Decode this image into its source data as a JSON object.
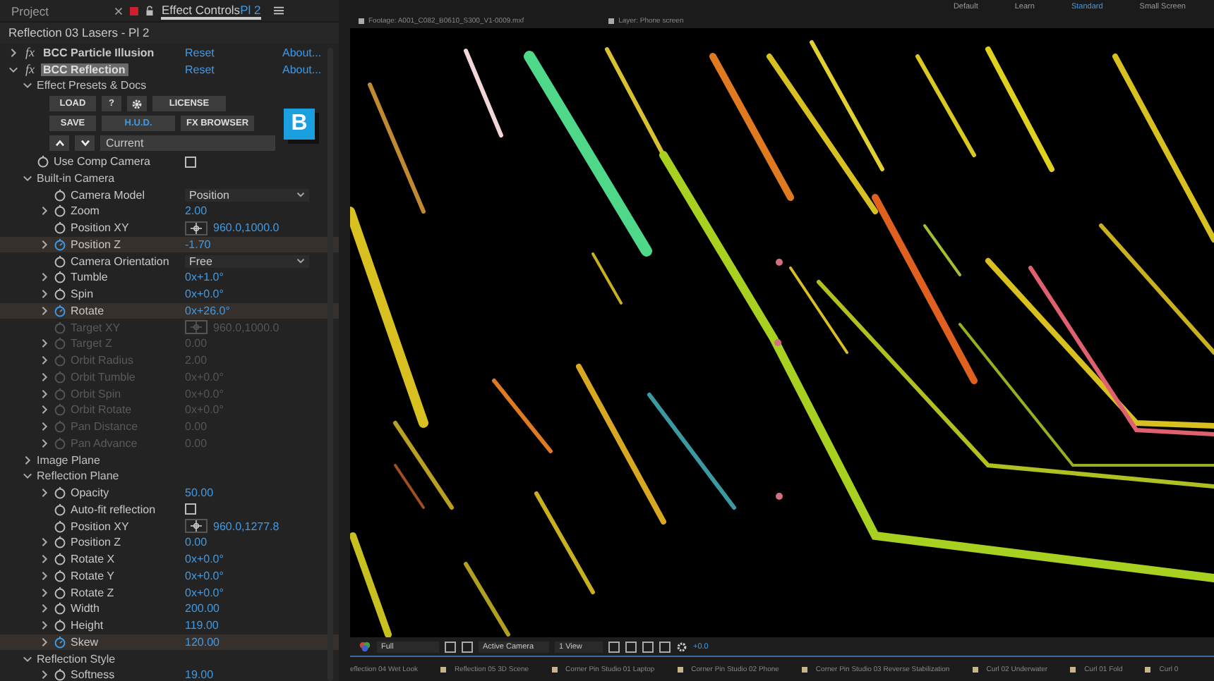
{
  "panel_tabs": [
    {
      "label": "Project",
      "selected": false
    },
    {
      "label": "Effect Controls",
      "suffix": "Pl 2",
      "selected": true
    }
  ],
  "layer_title": "Reflection 03 Lasers - Pl 2",
  "effects": [
    {
      "fx": "fx",
      "name": "BCC Particle Illusion",
      "reset": "Reset",
      "about": "About...",
      "expanded": false,
      "selected": false
    },
    {
      "fx": "fx",
      "name": "BCC Reflection",
      "reset": "Reset",
      "about": "About...",
      "expanded": true,
      "selected": true,
      "params": [
        {
          "kind": "presets",
          "label": "Effect Presets & Docs",
          "expanded": true,
          "logo": "B",
          "preset_field": "Current",
          "button_rows": [
            [
              {
                "kind": "text",
                "label": "LOAD",
                "on": false
              },
              {
                "kind": "text",
                "label": "?",
                "on": false
              },
              {
                "kind": "gear"
              },
              {
                "kind": "text",
                "label": "LICENSE",
                "on": false
              }
            ],
            [
              {
                "kind": "text",
                "label": "SAVE",
                "on": false
              },
              {
                "kind": "text",
                "label": "H.U.D.",
                "on": true
              },
              {
                "kind": "text",
                "label": "FX BROWSER",
                "on": false
              }
            ],
            [
              {
                "kind": "up"
              },
              {
                "kind": "down"
              }
            ]
          ]
        },
        {
          "kind": "checkbox",
          "label": "Use Comp Camera",
          "checked": false,
          "expandable": false,
          "keyframed": false,
          "disabled": false
        },
        {
          "kind": "section",
          "label": "Built-in Camera",
          "expanded": true,
          "children": [
            {
              "kind": "dropdown",
              "label": "Camera Model",
              "value": "Position",
              "expandable": false,
              "keyframed": false,
              "disabled": false
            },
            {
              "kind": "value",
              "label": "Zoom",
              "value": "2.00",
              "expandable": true,
              "keyframed": false,
              "disabled": false
            },
            {
              "kind": "point",
              "label": "Position XY",
              "value": "960.0,1000.0",
              "expandable": false,
              "keyframed": false,
              "disabled": false
            },
            {
              "kind": "value",
              "label": "Position Z",
              "value": "-1.70",
              "expandable": true,
              "keyframed": true,
              "disabled": false
            },
            {
              "kind": "dropdown",
              "label": "Camera Orientation",
              "value": "Free",
              "expandable": false,
              "keyframed": false,
              "disabled": false
            },
            {
              "kind": "value",
              "label": "Tumble",
              "value": "0x+1.0°",
              "expandable": true,
              "keyframed": false,
              "disabled": false
            },
            {
              "kind": "value",
              "label": "Spin",
              "value": "0x+0.0°",
              "expandable": true,
              "keyframed": false,
              "disabled": false
            },
            {
              "kind": "value",
              "label": "Rotate",
              "value": "0x+26.0°",
              "expandable": true,
              "keyframed": true,
              "disabled": false
            },
            {
              "kind": "point",
              "label": "Target XY",
              "value": "960.0,1000.0",
              "expandable": false,
              "keyframed": false,
              "disabled": true
            },
            {
              "kind": "value",
              "label": "Target Z",
              "value": "0.00",
              "expandable": true,
              "keyframed": false,
              "disabled": true
            },
            {
              "kind": "value",
              "label": "Orbit Radius",
              "value": "2.00",
              "expandable": true,
              "keyframed": false,
              "disabled": true
            },
            {
              "kind": "value",
              "label": "Orbit Tumble",
              "value": "0x+0.0°",
              "expandable": true,
              "keyframed": false,
              "disabled": true
            },
            {
              "kind": "value",
              "label": "Orbit Spin",
              "value": "0x+0.0°",
              "expandable": true,
              "keyframed": false,
              "disabled": true
            },
            {
              "kind": "value",
              "label": "Orbit Rotate",
              "value": "0x+0.0°",
              "expandable": true,
              "keyframed": false,
              "disabled": true
            },
            {
              "kind": "value",
              "label": "Pan Distance",
              "value": "0.00",
              "expandable": true,
              "keyframed": false,
              "disabled": true
            },
            {
              "kind": "value",
              "label": "Pan Advance",
              "value": "0.00",
              "expandable": true,
              "keyframed": false,
              "disabled": true
            }
          ]
        },
        {
          "kind": "section",
          "label": "Image Plane",
          "expanded": false
        },
        {
          "kind": "section",
          "label": "Reflection Plane",
          "expanded": true,
          "children": [
            {
              "kind": "value",
              "label": "Opacity",
              "value": "50.00",
              "expandable": true,
              "keyframed": false,
              "disabled": false
            },
            {
              "kind": "checkbox",
              "label": "Auto-fit reflection",
              "checked": false,
              "expandable": false,
              "keyframed": false,
              "disabled": false
            },
            {
              "kind": "point",
              "label": "Position XY",
              "value": "960.0,1277.8",
              "expandable": false,
              "keyframed": false,
              "disabled": false
            },
            {
              "kind": "value",
              "label": "Position Z",
              "value": "0.00",
              "expandable": true,
              "keyframed": false,
              "disabled": false
            },
            {
              "kind": "value",
              "label": "Rotate X",
              "value": "0x+0.0°",
              "expandable": true,
              "keyframed": false,
              "disabled": false
            },
            {
              "kind": "value",
              "label": "Rotate Y",
              "value": "0x+0.0°",
              "expandable": true,
              "keyframed": false,
              "disabled": false
            },
            {
              "kind": "value",
              "label": "Rotate Z",
              "value": "0x+0.0°",
              "expandable": true,
              "keyframed": false,
              "disabled": false
            },
            {
              "kind": "value",
              "label": "Width",
              "value": "200.00",
              "expandable": true,
              "keyframed": false,
              "disabled": false
            },
            {
              "kind": "value",
              "label": "Height",
              "value": "119.00",
              "expandable": true,
              "keyframed": false,
              "disabled": false
            },
            {
              "kind": "value",
              "label": "Skew",
              "value": "120.00",
              "expandable": true,
              "keyframed": true,
              "disabled": false
            }
          ]
        },
        {
          "kind": "section",
          "label": "Reflection Style",
          "expanded": true,
          "children": [
            {
              "kind": "value",
              "label": "Softness",
              "value": "19.00",
              "expandable": true,
              "keyframed": false,
              "disabled": false
            }
          ]
        }
      ]
    }
  ],
  "workspaces": [
    {
      "label": "Default",
      "selected": false
    },
    {
      "label": "Learn",
      "selected": false
    },
    {
      "label": "Standard",
      "selected": true
    },
    {
      "label": "Small Screen",
      "selected": false
    }
  ],
  "viewer_tabs": [
    {
      "label": "Footage: A001_C082_B0610_S300_V1-0009.mxf"
    },
    {
      "label": "Layer: Phone screen"
    }
  ],
  "viewer_controls": {
    "resolution": "Full",
    "camera": "Active Camera",
    "views": "1 View",
    "exposure": "+0.0"
  },
  "timeline_tabs": [
    {
      "label": "eflection 04 Wet Look",
      "swatch": false
    },
    {
      "label": "Reflection 05 3D Scene",
      "swatch": true
    },
    {
      "label": "Corner Pin Studio 01 Laptop",
      "swatch": true
    },
    {
      "label": "Corner Pin Studio 02 Phone",
      "swatch": true
    },
    {
      "label": "Corner Pin Studio 03 Reverse Stabilization",
      "swatch": true
    },
    {
      "label": "Curl 02 Underwater",
      "swatch": true
    },
    {
      "label": "Curl 01 Fold",
      "swatch": true
    },
    {
      "label": "Curl 0",
      "swatch": true
    }
  ]
}
